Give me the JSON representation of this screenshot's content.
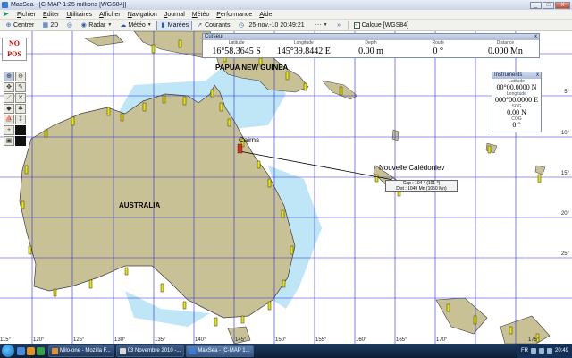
{
  "window": {
    "title": "MaxSea - [C-MAP  1:25 millions [WGS84]]",
    "controls": [
      "_",
      "□",
      "X"
    ]
  },
  "menu": [
    "Fichier",
    "Editer",
    "Utilitaires",
    "Afficher",
    "Navigation",
    "Journal",
    "Météo",
    "Performance",
    "Aide"
  ],
  "toolbar": {
    "centrer": "Centrer",
    "view2d": "2D",
    "radar": "Radar",
    "meteo": "Météo",
    "marees": "Marées",
    "courants": "Courants",
    "datetime": "25-nov.-10 20:49:21",
    "calque": "Calque [WGS84]"
  },
  "status": {
    "line1": "NO",
    "line2": "POS"
  },
  "cursor_panel": {
    "title": "Curseur",
    "close": "x",
    "fields": [
      {
        "label": "Latitude",
        "value": "16°58.3645 S"
      },
      {
        "label": "Longitude",
        "value": "145°39.8442 E"
      },
      {
        "label": "Depth",
        "value": "0.00 m"
      },
      {
        "label": "Route",
        "value": "0 °"
      },
      {
        "label": "Distance",
        "value": "0.000 Mn"
      }
    ]
  },
  "instruments_panel": {
    "title": "Instruments",
    "close": "x",
    "fields": [
      {
        "label": "Latitude",
        "value": "00°00.0000 N"
      },
      {
        "label": "Longitude",
        "value": "000°00.0000 E"
      },
      {
        "label": "SOG",
        "value": "0.00 N"
      },
      {
        "label": "COG",
        "value": "0 °"
      }
    ]
  },
  "map": {
    "places": {
      "papua": "PAPUA NEW GUINEA",
      "cairns": "Cairns",
      "australia": "AUSTRALIA",
      "nouvelle": "Nouvelle Calédoniev"
    },
    "route_tip": {
      "line1": "Cap : 104 ° (101 °)",
      "line2": "Dist : 1049 Mn (1050 Mn)"
    },
    "lon_labels": [
      "115°",
      "120°",
      "125°",
      "130°",
      "135°",
      "140°",
      "145°",
      "150°",
      "155°",
      "160°",
      "165°",
      "170°",
      "175°"
    ],
    "lat_labels": [
      "5°",
      "10°",
      "15°",
      "20°",
      "25°"
    ],
    "colors": {
      "land": "#c9c196",
      "shallow": "#bfe6f7",
      "grid": "#2a2ad0",
      "tide": "#e6e600"
    }
  },
  "taskbar": {
    "items": [
      {
        "label": "Milo-one - Mozilla F..."
      },
      {
        "label": "03 Novembre 2010 -..."
      },
      {
        "label": "MaxSea - [C-MAP 1..."
      }
    ],
    "lang": "FR",
    "clock": "20:49"
  }
}
